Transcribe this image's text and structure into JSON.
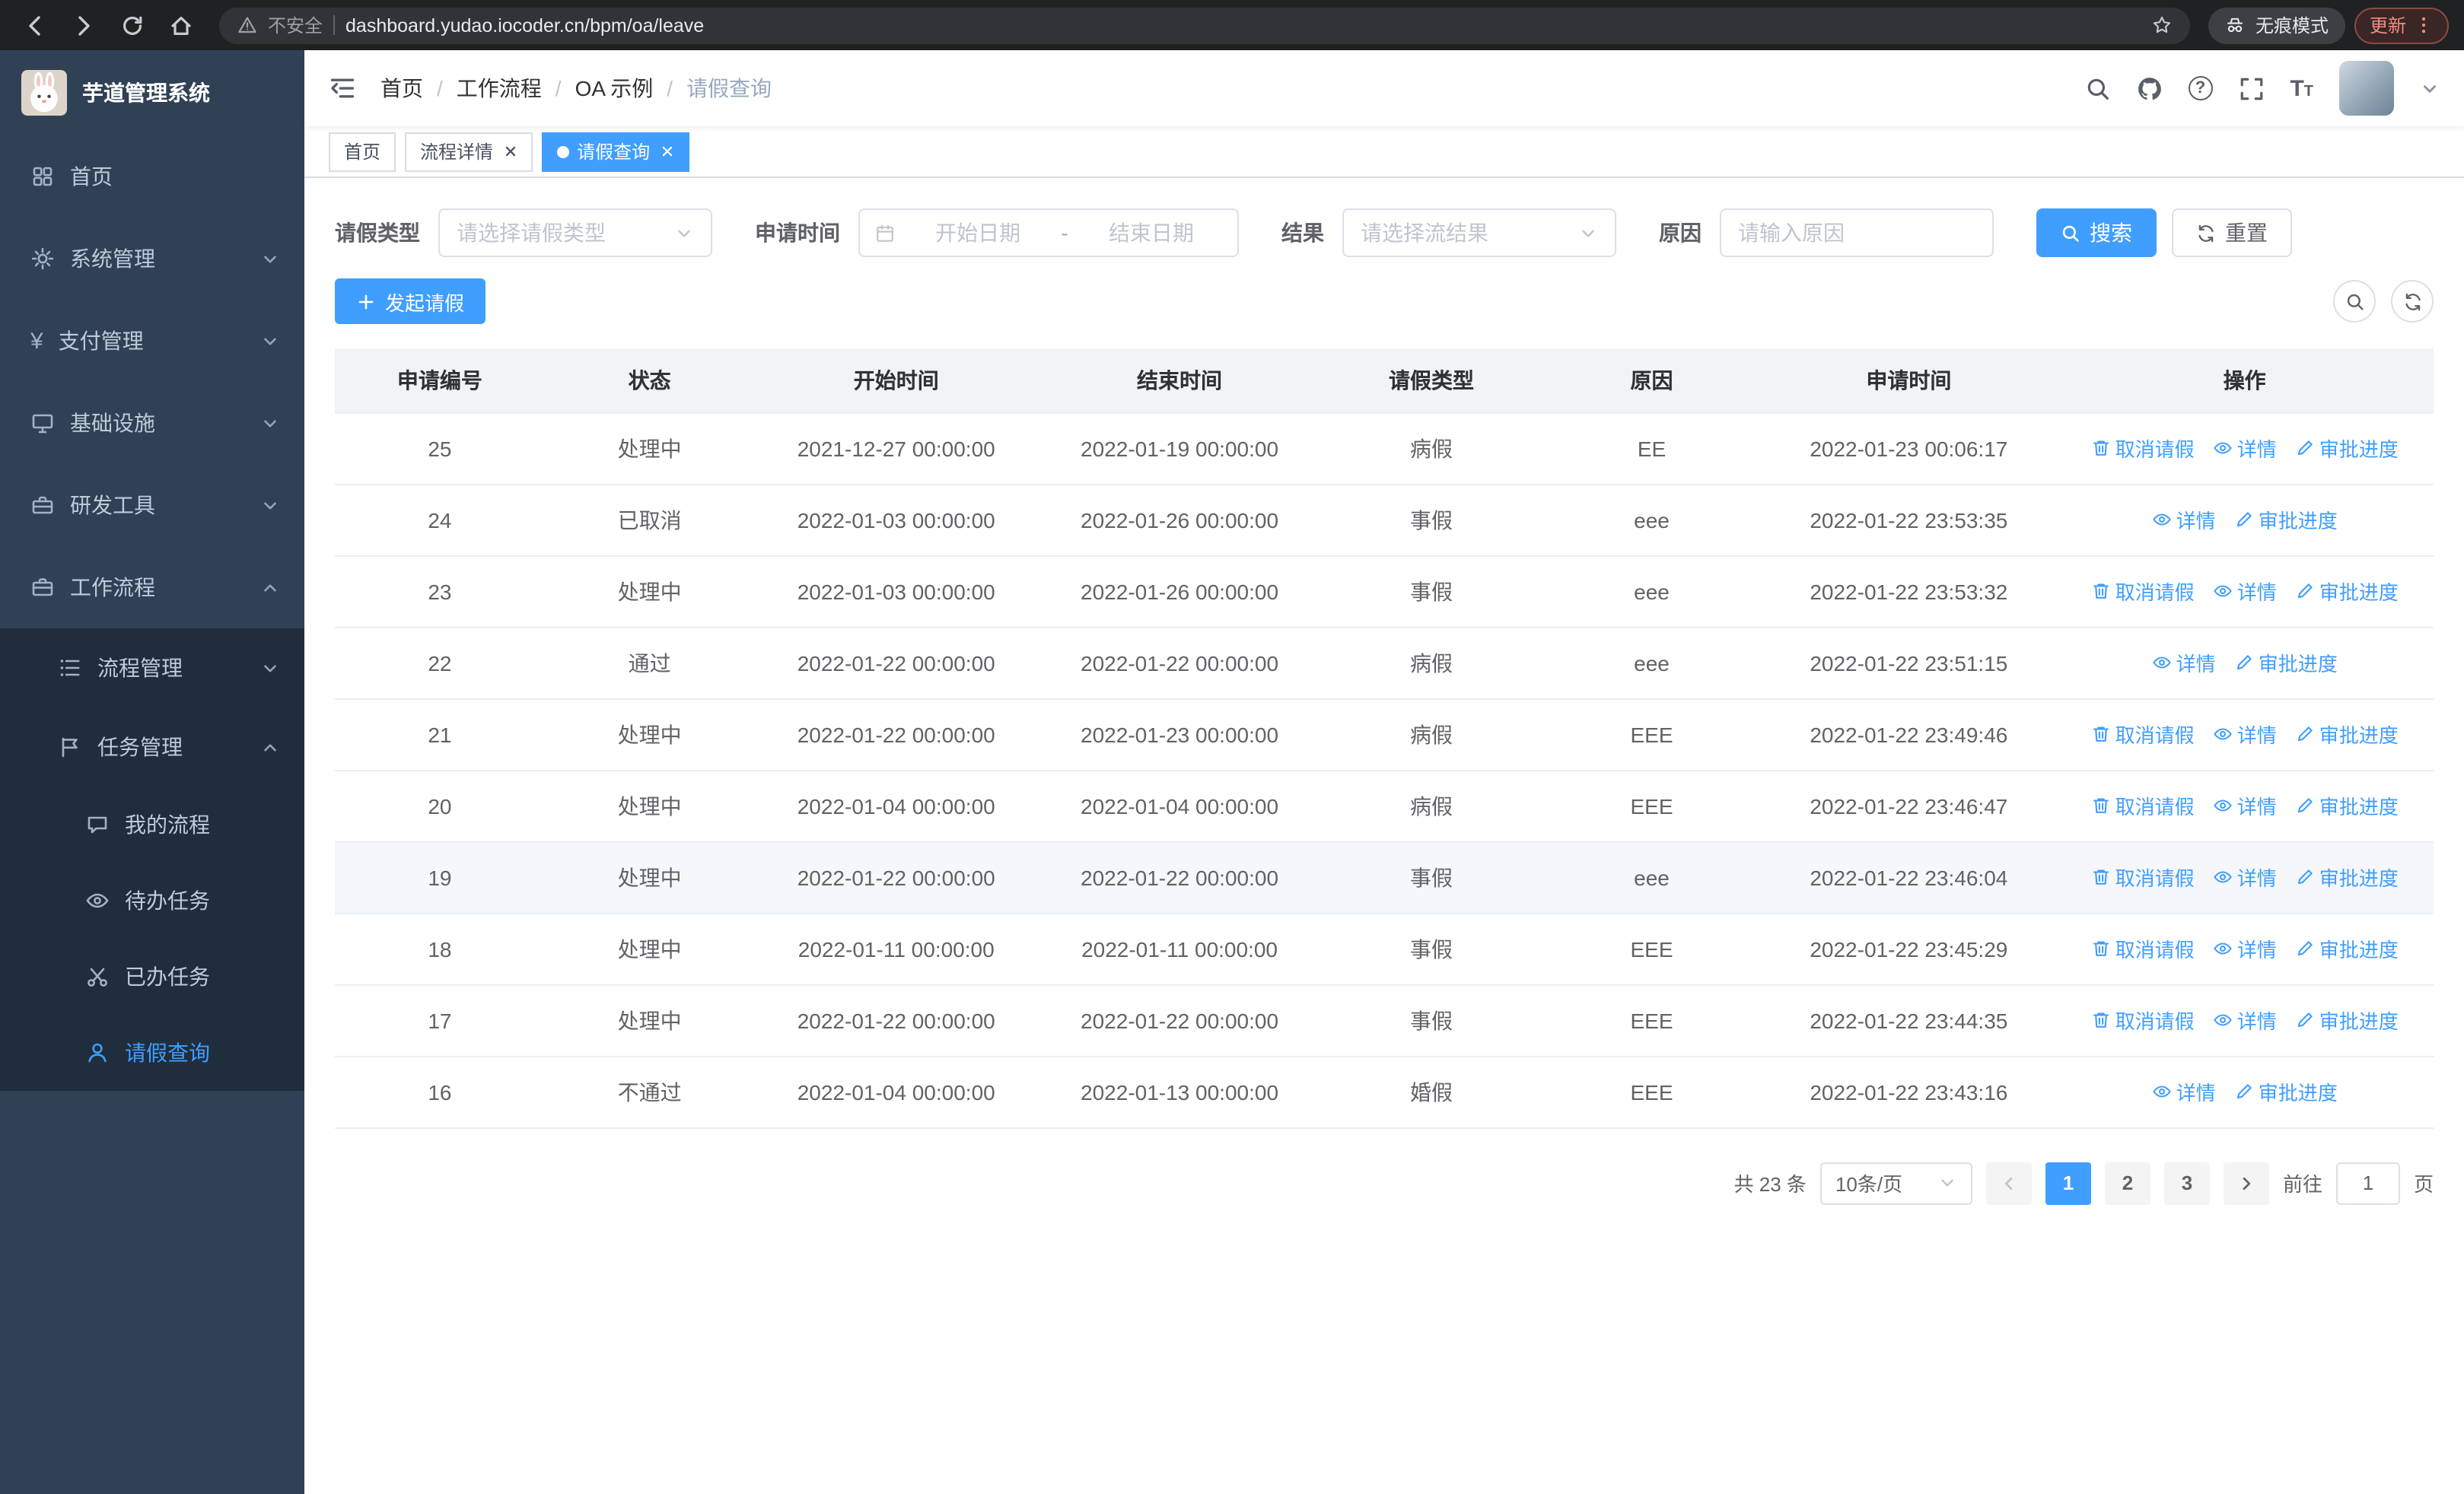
{
  "browser": {
    "security_warning": "不安全",
    "url": "dashboard.yudao.iocoder.cn/bpm/oa/leave",
    "incognito_label": "无痕模式",
    "update_label": "更新"
  },
  "app": {
    "title": "芋道管理系统"
  },
  "sidebar": {
    "items": [
      {
        "label": "首页",
        "icon": "dashboard-icon"
      },
      {
        "label": "系统管理",
        "icon": "gear-icon"
      },
      {
        "label": "支付管理",
        "icon": "yen-icon"
      },
      {
        "label": "基础设施",
        "icon": "monitor-icon"
      },
      {
        "label": "研发工具",
        "icon": "toolbox-icon"
      },
      {
        "label": "工作流程",
        "icon": "briefcase-icon"
      }
    ],
    "submenu": [
      {
        "label": "流程管理",
        "icon": "list-icon"
      },
      {
        "label": "任务管理",
        "icon": "flag-icon"
      }
    ],
    "tasks": [
      {
        "label": "我的流程",
        "icon": "chat-icon"
      },
      {
        "label": "待办任务",
        "icon": "eye-icon"
      },
      {
        "label": "已办任务",
        "icon": "scissors-icon"
      },
      {
        "label": "请假查询",
        "icon": "user-icon"
      }
    ]
  },
  "header": {
    "breadcrumb": [
      "首页",
      "工作流程",
      "OA 示例",
      "请假查询"
    ]
  },
  "tabs": [
    {
      "label": "首页"
    },
    {
      "label": "流程详情"
    },
    {
      "label": "请假查询"
    }
  ],
  "filters": {
    "leave_type_label": "请假类型",
    "leave_type_placeholder": "请选择请假类型",
    "apply_time_label": "申请时间",
    "start_date_placeholder": "开始日期",
    "range_separator": "-",
    "end_date_placeholder": "结束日期",
    "result_label": "结果",
    "result_placeholder": "请选择流结果",
    "reason_label": "原因",
    "reason_placeholder": "请输入原因",
    "search_button": "搜索",
    "reset_button": "重置"
  },
  "toolbar": {
    "create_button": "发起请假"
  },
  "table": {
    "columns": [
      "申请编号",
      "状态",
      "开始时间",
      "结束时间",
      "请假类型",
      "原因",
      "申请时间",
      "操作"
    ],
    "actions": {
      "cancel": {
        "label": "取消请假",
        "icon": "trash-icon"
      },
      "detail": {
        "label": "详情",
        "icon": "view-icon"
      },
      "progress": {
        "label": "审批进度",
        "icon": "edit-icon"
      }
    },
    "rows": [
      {
        "id": "25",
        "status": "处理中",
        "start": "2021-12-27 00:00:00",
        "end": "2022-01-19 00:00:00",
        "type": "病假",
        "reason": "EE",
        "applied": "2022-01-23 00:06:17",
        "cancellable": true,
        "highlighted": false
      },
      {
        "id": "24",
        "status": "已取消",
        "start": "2022-01-03 00:00:00",
        "end": "2022-01-26 00:00:00",
        "type": "事假",
        "reason": "eee",
        "applied": "2022-01-22 23:53:35",
        "cancellable": false,
        "highlighted": false
      },
      {
        "id": "23",
        "status": "处理中",
        "start": "2022-01-03 00:00:00",
        "end": "2022-01-26 00:00:00",
        "type": "事假",
        "reason": "eee",
        "applied": "2022-01-22 23:53:32",
        "cancellable": true,
        "highlighted": false
      },
      {
        "id": "22",
        "status": "通过",
        "start": "2022-01-22 00:00:00",
        "end": "2022-01-22 00:00:00",
        "type": "病假",
        "reason": "eee",
        "applied": "2022-01-22 23:51:15",
        "cancellable": false,
        "highlighted": false
      },
      {
        "id": "21",
        "status": "处理中",
        "start": "2022-01-22 00:00:00",
        "end": "2022-01-23 00:00:00",
        "type": "病假",
        "reason": "EEE",
        "applied": "2022-01-22 23:49:46",
        "cancellable": true,
        "highlighted": false
      },
      {
        "id": "20",
        "status": "处理中",
        "start": "2022-01-04 00:00:00",
        "end": "2022-01-04 00:00:00",
        "type": "病假",
        "reason": "EEE",
        "applied": "2022-01-22 23:46:47",
        "cancellable": true,
        "highlighted": false
      },
      {
        "id": "19",
        "status": "处理中",
        "start": "2022-01-22 00:00:00",
        "end": "2022-01-22 00:00:00",
        "type": "事假",
        "reason": "eee",
        "applied": "2022-01-22 23:46:04",
        "cancellable": true,
        "highlighted": true
      },
      {
        "id": "18",
        "status": "处理中",
        "start": "2022-01-11 00:00:00",
        "end": "2022-01-11 00:00:00",
        "type": "事假",
        "reason": "EEE",
        "applied": "2022-01-22 23:45:29",
        "cancellable": true,
        "highlighted": false
      },
      {
        "id": "17",
        "status": "处理中",
        "start": "2022-01-22 00:00:00",
        "end": "2022-01-22 00:00:00",
        "type": "事假",
        "reason": "EEE",
        "applied": "2022-01-22 23:44:35",
        "cancellable": true,
        "highlighted": false
      },
      {
        "id": "16",
        "status": "不通过",
        "start": "2022-01-04 00:00:00",
        "end": "2022-01-13 00:00:00",
        "type": "婚假",
        "reason": "EEE",
        "applied": "2022-01-22 23:43:16",
        "cancellable": false,
        "highlighted": false
      }
    ]
  },
  "pagination": {
    "total_text": "共 23 条",
    "page_size": "10条/页",
    "pages": [
      "1",
      "2",
      "3"
    ],
    "active_page": "1",
    "goto_label": "前往",
    "goto_value": "1",
    "page_suffix": "页"
  },
  "colors": {
    "primary": "#409eff",
    "sidebar_bg": "#304156",
    "submenu_bg": "#1f2d3d",
    "active_tab_bg": "#409eff"
  }
}
